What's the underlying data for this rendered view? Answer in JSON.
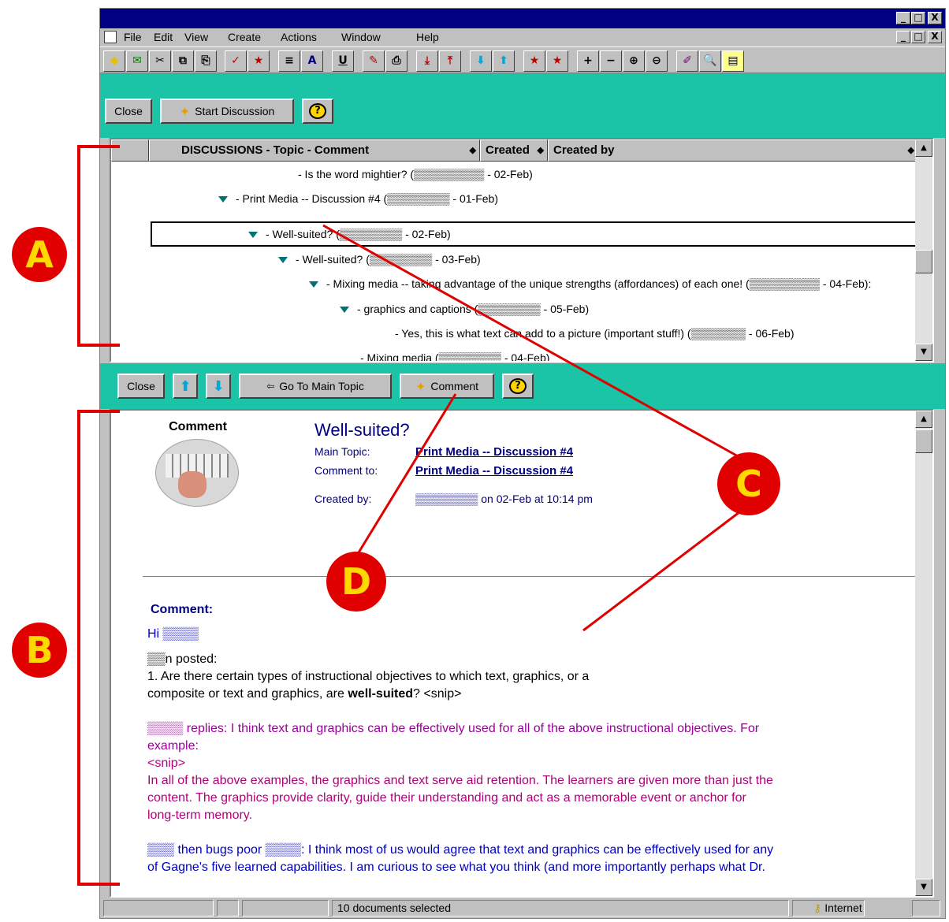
{
  "menu": [
    "File",
    "Edit",
    "View",
    "Create",
    "Actions",
    "Window",
    "Help"
  ],
  "window_controls": {
    "minimize": "_",
    "restore": "□",
    "close": "X"
  },
  "view_action_bar": {
    "close": "Close",
    "start_discussion": "Start Discussion",
    "help": "?"
  },
  "view": {
    "columns": [
      "DISCUSSIONS - Topic - Comment",
      "Created",
      "Created by"
    ],
    "rows": [
      "- Is the word mightier? (▒▒▒▒▒▒▒▒▒ - 02-Feb)",
      "- Print Media -- Discussion #4 (▒▒▒▒▒▒▒▒ - 01-Feb)",
      "- Well-suited? (▒▒▒▒▒▒▒▒ - 02-Feb)",
      "- Well-suited? (▒▒▒▒▒▒▒▒ - 03-Feb)",
      "- Mixing media -- taking advantage of the unique strengths (affordances) of each one! (▒▒▒▒▒▒▒▒▒ - 04-Feb):",
      "- graphics and captions (▒▒▒▒▒▒▒▒ - 05-Feb)",
      "- Yes, this is what text can add to a picture (important stuff!) (▒▒▒▒▒▒▒ - 06-Feb)",
      "- Mixing media (▒▒▒▒▒▒▒▒ - 04-Feb)"
    ]
  },
  "doc_action_bar": {
    "close": "Close",
    "go_main": "Go To Main Topic",
    "comment": "Comment",
    "help": "?"
  },
  "document": {
    "badge": "Comment",
    "title": "Well-suited?",
    "main_topic_label": "Main Topic:",
    "main_topic_value": "Print Media -- Discussion #4",
    "comment_to_label": "Comment to:",
    "comment_to_value": "Print Media -- Discussion #4",
    "created_by_label": "Created by:",
    "created_by_value": "▒▒▒▒▒▒▒▒ on 02-Feb at 10:14 pm",
    "comment_heading": "Comment:",
    "greeting": "Hi ▒▒▒▒",
    "posted": "▒▒n posted:",
    "question_1": "1. Are there certain types of instructional objectives to which text, graphics, or a",
    "question_2_pre": "composite or text and graphics, are ",
    "question_2_bold": "well-suited",
    "question_2_post": "? <snip>",
    "reply_1": "▒▒▒▒ replies: I think text and graphics can be effectively used for all of the above instructional objectives.  For",
    "reply_2": "example:",
    "snip": "<snip>",
    "para_1": "In all of the above examples, the graphics and text serve aid retention.  The learners are given more than just the",
    "para_2": "content.  The graphics provide clarity, guide their understanding and act as a memorable event or anchor for",
    "para_3": "long-term memory.",
    "followup_1": "▒▒▒ then bugs poor ▒▒▒▒: I think most of us would agree that text and graphics can be effectively used for any",
    "followup_2": "of Gagne's five learned capabilities.  I am curious to see what you think (and more importantly perhaps what Dr."
  },
  "status_bar": {
    "docs": "10 documents selected",
    "zone": "Internet"
  },
  "annotations": {
    "a": "A",
    "b": "B",
    "c": "C",
    "d": "D"
  },
  "colors": {
    "title_bar": "#000080",
    "action_bar": "#1bc4a6",
    "annotation": "#e00000",
    "annotation_text": "#ffd800"
  }
}
